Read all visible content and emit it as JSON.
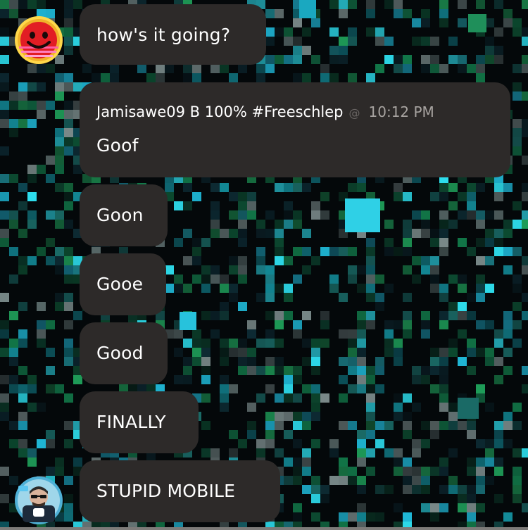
{
  "colors": {
    "bubble": "#2d2a29",
    "message_text": "#ffffff",
    "timestamp": "#a7a3a0",
    "mention_symbol": "#6a6664",
    "background": "#04080a"
  },
  "messages": [
    {
      "text": "how's it going?"
    },
    {
      "sender": "Jamisawe09 B 100% #Freeschlep",
      "mention_symbol": "@",
      "timestamp": "10:12 PM",
      "text": "Goof"
    },
    {
      "text": "Goon"
    },
    {
      "text": "Gooe"
    },
    {
      "text": "Good"
    },
    {
      "text": "FINALLY"
    },
    {
      "text": "STUPID MOBILE"
    }
  ],
  "avatars": [
    {
      "icon": "red-smiley-face-icon"
    },
    {
      "icon": "cartoon-character-icon"
    }
  ]
}
